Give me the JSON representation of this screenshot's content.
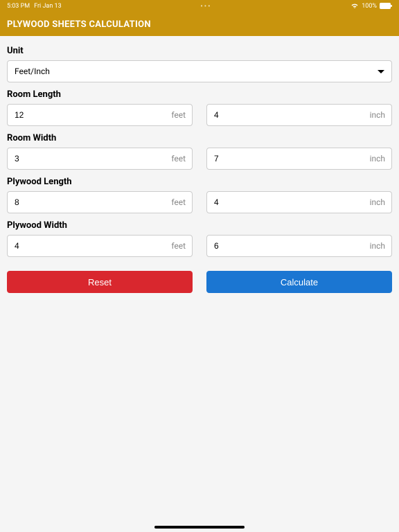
{
  "statusBar": {
    "time": "5:03 PM",
    "date": "Fri Jan 13",
    "dots": "•••",
    "battery": "100%"
  },
  "header": {
    "title": "PLYWOOD SHEETS CALCULATION"
  },
  "form": {
    "unit": {
      "label": "Unit",
      "value": "Feet/Inch"
    },
    "roomLength": {
      "label": "Room Length",
      "feet": "12",
      "inch": "4",
      "feetSuffix": "feet",
      "inchSuffix": "inch"
    },
    "roomWidth": {
      "label": "Room Width",
      "feet": "3",
      "inch": "7",
      "feetSuffix": "feet",
      "inchSuffix": "inch"
    },
    "plywoodLength": {
      "label": "Plywood Length",
      "feet": "8",
      "inch": "4",
      "feetSuffix": "feet",
      "inchSuffix": "inch"
    },
    "plywoodWidth": {
      "label": "Plywood Width",
      "feet": "4",
      "inch": "6",
      "feetSuffix": "feet",
      "inchSuffix": "inch"
    }
  },
  "buttons": {
    "reset": "Reset",
    "calculate": "Calculate"
  }
}
